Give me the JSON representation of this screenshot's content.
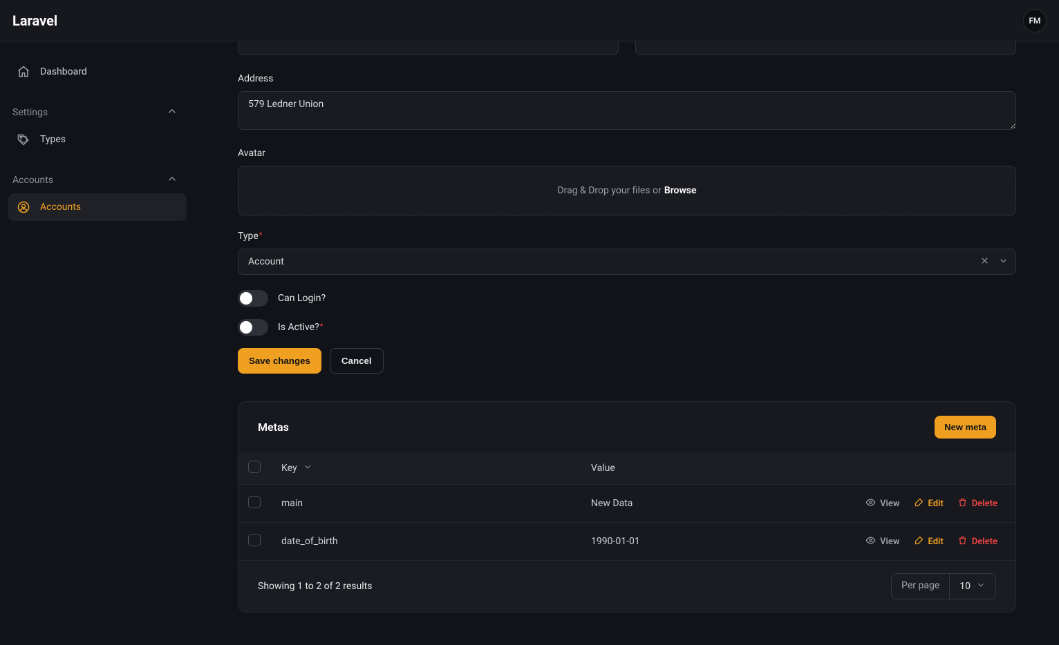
{
  "brand": "Laravel",
  "user": {
    "initials": "FM"
  },
  "sidebar": {
    "dashboard": "Dashboard",
    "groups": [
      {
        "label": "Settings",
        "items": [
          {
            "label": "Types"
          }
        ]
      },
      {
        "label": "Accounts",
        "items": [
          {
            "label": "Accounts"
          }
        ]
      }
    ]
  },
  "form": {
    "address_label": "Address",
    "address_value": "579 Ledner Union",
    "avatar_label": "Avatar",
    "dropzone_text": "Drag & Drop your files or",
    "dropzone_browse": "Browse",
    "type_label": "Type",
    "type_value": "Account",
    "can_login_label": "Can Login?",
    "is_active_label": "Is Active?",
    "save_label": "Save changes",
    "cancel_label": "Cancel"
  },
  "metas": {
    "title": "Metas",
    "new_button": "New meta",
    "columns": {
      "key": "Key",
      "value": "Value"
    },
    "rows": [
      {
        "key": "main",
        "value": "New Data"
      },
      {
        "key": "date_of_birth",
        "value": "1990-01-01"
      }
    ],
    "actions": {
      "view": "View",
      "edit": "Edit",
      "delete": "Delete"
    },
    "footer": {
      "summary": "Showing 1 to 2 of 2 results",
      "per_page_label": "Per page",
      "per_page_value": "10"
    }
  }
}
